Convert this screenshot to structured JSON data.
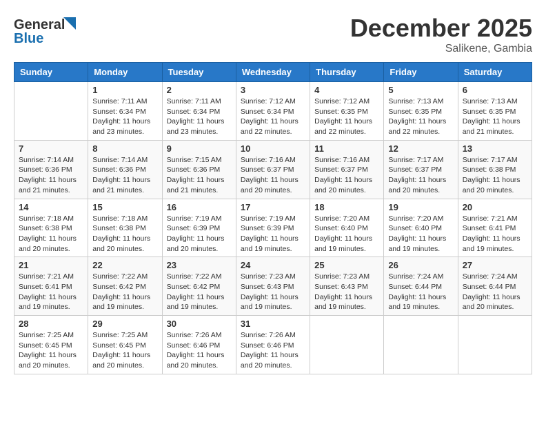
{
  "header": {
    "logo_line1": "General",
    "logo_line2": "Blue",
    "month": "December 2025",
    "location": "Salikene, Gambia"
  },
  "days_of_week": [
    "Sunday",
    "Monday",
    "Tuesday",
    "Wednesday",
    "Thursday",
    "Friday",
    "Saturday"
  ],
  "weeks": [
    [
      {
        "day": "",
        "info": ""
      },
      {
        "day": "1",
        "info": "Sunrise: 7:11 AM\nSunset: 6:34 PM\nDaylight: 11 hours and 23 minutes."
      },
      {
        "day": "2",
        "info": "Sunrise: 7:11 AM\nSunset: 6:34 PM\nDaylight: 11 hours and 23 minutes."
      },
      {
        "day": "3",
        "info": "Sunrise: 7:12 AM\nSunset: 6:34 PM\nDaylight: 11 hours and 22 minutes."
      },
      {
        "day": "4",
        "info": "Sunrise: 7:12 AM\nSunset: 6:35 PM\nDaylight: 11 hours and 22 minutes."
      },
      {
        "day": "5",
        "info": "Sunrise: 7:13 AM\nSunset: 6:35 PM\nDaylight: 11 hours and 22 minutes."
      },
      {
        "day": "6",
        "info": "Sunrise: 7:13 AM\nSunset: 6:35 PM\nDaylight: 11 hours and 21 minutes."
      }
    ],
    [
      {
        "day": "7",
        "info": "Sunrise: 7:14 AM\nSunset: 6:36 PM\nDaylight: 11 hours and 21 minutes."
      },
      {
        "day": "8",
        "info": "Sunrise: 7:14 AM\nSunset: 6:36 PM\nDaylight: 11 hours and 21 minutes."
      },
      {
        "day": "9",
        "info": "Sunrise: 7:15 AM\nSunset: 6:36 PM\nDaylight: 11 hours and 21 minutes."
      },
      {
        "day": "10",
        "info": "Sunrise: 7:16 AM\nSunset: 6:37 PM\nDaylight: 11 hours and 20 minutes."
      },
      {
        "day": "11",
        "info": "Sunrise: 7:16 AM\nSunset: 6:37 PM\nDaylight: 11 hours and 20 minutes."
      },
      {
        "day": "12",
        "info": "Sunrise: 7:17 AM\nSunset: 6:37 PM\nDaylight: 11 hours and 20 minutes."
      },
      {
        "day": "13",
        "info": "Sunrise: 7:17 AM\nSunset: 6:38 PM\nDaylight: 11 hours and 20 minutes."
      }
    ],
    [
      {
        "day": "14",
        "info": "Sunrise: 7:18 AM\nSunset: 6:38 PM\nDaylight: 11 hours and 20 minutes."
      },
      {
        "day": "15",
        "info": "Sunrise: 7:18 AM\nSunset: 6:38 PM\nDaylight: 11 hours and 20 minutes."
      },
      {
        "day": "16",
        "info": "Sunrise: 7:19 AM\nSunset: 6:39 PM\nDaylight: 11 hours and 20 minutes."
      },
      {
        "day": "17",
        "info": "Sunrise: 7:19 AM\nSunset: 6:39 PM\nDaylight: 11 hours and 19 minutes."
      },
      {
        "day": "18",
        "info": "Sunrise: 7:20 AM\nSunset: 6:40 PM\nDaylight: 11 hours and 19 minutes."
      },
      {
        "day": "19",
        "info": "Sunrise: 7:20 AM\nSunset: 6:40 PM\nDaylight: 11 hours and 19 minutes."
      },
      {
        "day": "20",
        "info": "Sunrise: 7:21 AM\nSunset: 6:41 PM\nDaylight: 11 hours and 19 minutes."
      }
    ],
    [
      {
        "day": "21",
        "info": "Sunrise: 7:21 AM\nSunset: 6:41 PM\nDaylight: 11 hours and 19 minutes."
      },
      {
        "day": "22",
        "info": "Sunrise: 7:22 AM\nSunset: 6:42 PM\nDaylight: 11 hours and 19 minutes."
      },
      {
        "day": "23",
        "info": "Sunrise: 7:22 AM\nSunset: 6:42 PM\nDaylight: 11 hours and 19 minutes."
      },
      {
        "day": "24",
        "info": "Sunrise: 7:23 AM\nSunset: 6:43 PM\nDaylight: 11 hours and 19 minutes."
      },
      {
        "day": "25",
        "info": "Sunrise: 7:23 AM\nSunset: 6:43 PM\nDaylight: 11 hours and 19 minutes."
      },
      {
        "day": "26",
        "info": "Sunrise: 7:24 AM\nSunset: 6:44 PM\nDaylight: 11 hours and 19 minutes."
      },
      {
        "day": "27",
        "info": "Sunrise: 7:24 AM\nSunset: 6:44 PM\nDaylight: 11 hours and 20 minutes."
      }
    ],
    [
      {
        "day": "28",
        "info": "Sunrise: 7:25 AM\nSunset: 6:45 PM\nDaylight: 11 hours and 20 minutes."
      },
      {
        "day": "29",
        "info": "Sunrise: 7:25 AM\nSunset: 6:45 PM\nDaylight: 11 hours and 20 minutes."
      },
      {
        "day": "30",
        "info": "Sunrise: 7:26 AM\nSunset: 6:46 PM\nDaylight: 11 hours and 20 minutes."
      },
      {
        "day": "31",
        "info": "Sunrise: 7:26 AM\nSunset: 6:46 PM\nDaylight: 11 hours and 20 minutes."
      },
      {
        "day": "",
        "info": ""
      },
      {
        "day": "",
        "info": ""
      },
      {
        "day": "",
        "info": ""
      }
    ]
  ]
}
